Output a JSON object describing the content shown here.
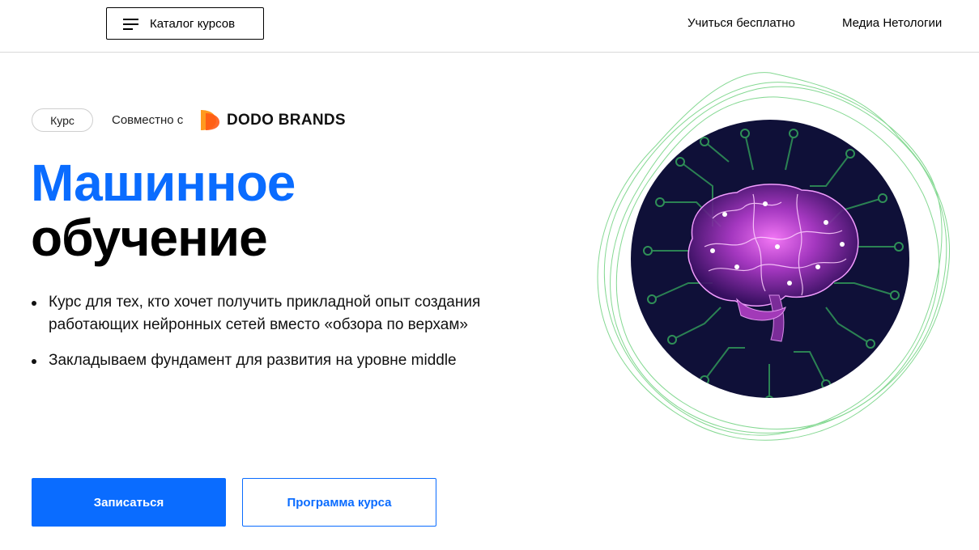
{
  "header": {
    "catalog_label": "Каталог курсов",
    "nav": [
      {
        "label": "Учиться бесплатно"
      },
      {
        "label": "Медиа Нетологии"
      }
    ]
  },
  "hero": {
    "tag": "Курс",
    "partner_prefix": "Совместно с",
    "partner_name": "DODO BRANDS",
    "title_line1": "Машинное",
    "title_line2": "обучение",
    "bullets": [
      "Курс для тех, кто хочет получить прикладной опыт создания работающих нейронных сетей вместо «обзора по верхам»",
      "Закладываем фундамент для развития на уровне middle"
    ],
    "primary_button": "Записаться",
    "secondary_button": "Программа курса"
  },
  "colors": {
    "accent": "#0a6cff",
    "partner_logo": "#ff6a13",
    "illustration_bg": "#0f1038",
    "circuit": "#2f8f57",
    "brain": "#c93fd6"
  },
  "icons": {
    "menu": "burger-menu-icon",
    "partner_logo": "dodo-brands-logo",
    "illustration": "brain-circuit-illustration"
  }
}
